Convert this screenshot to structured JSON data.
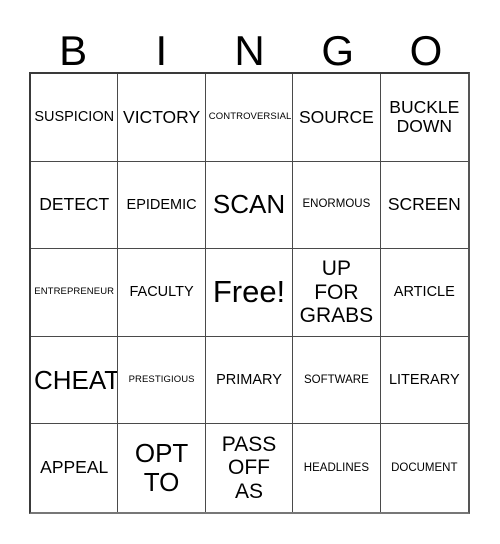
{
  "card": {
    "type": "bingo-card",
    "background_color": "#ffffff",
    "text_color": "#000000",
    "border_color": "#4a4a4a",
    "columns": 5,
    "rows": 5
  },
  "header": {
    "letters": [
      "B",
      "I",
      "N",
      "G",
      "O"
    ]
  },
  "grid": {
    "cells": [
      {
        "text": "SUSPICION",
        "size": "sz-m"
      },
      {
        "text": "VICTORY",
        "size": "sz-l"
      },
      {
        "text": "CONTROVERSIAL",
        "size": "sz-xs"
      },
      {
        "text": "SOURCE",
        "size": "sz-l"
      },
      {
        "text": "BUCKLE\nDOWN",
        "size": "sz-l"
      },
      {
        "text": "DETECT",
        "size": "sz-l"
      },
      {
        "text": "EPIDEMIC",
        "size": "sz-m"
      },
      {
        "text": "SCAN",
        "size": "sz-xxl"
      },
      {
        "text": "ENORMOUS",
        "size": "sz-s"
      },
      {
        "text": "SCREEN",
        "size": "sz-l"
      },
      {
        "text": "ENTREPRENEUR",
        "size": "sz-xs"
      },
      {
        "text": "FACULTY",
        "size": "sz-m"
      },
      {
        "text": "Free!",
        "size": "sz-free"
      },
      {
        "text": "UP\nFOR\nGRABS",
        "size": "sz-xl"
      },
      {
        "text": "ARTICLE",
        "size": "sz-m"
      },
      {
        "text": "CHEAT",
        "size": "sz-xxl"
      },
      {
        "text": "PRESTIGIOUS",
        "size": "sz-xs"
      },
      {
        "text": "PRIMARY",
        "size": "sz-m"
      },
      {
        "text": "SOFTWARE",
        "size": "sz-s"
      },
      {
        "text": "LITERARY",
        "size": "sz-m"
      },
      {
        "text": "APPEAL",
        "size": "sz-l"
      },
      {
        "text": "OPT\nTO",
        "size": "sz-xxl"
      },
      {
        "text": "PASS\nOFF\nAS",
        "size": "sz-xl"
      },
      {
        "text": "HEADLINES",
        "size": "sz-s"
      },
      {
        "text": "DOCUMENT",
        "size": "sz-s"
      }
    ]
  }
}
